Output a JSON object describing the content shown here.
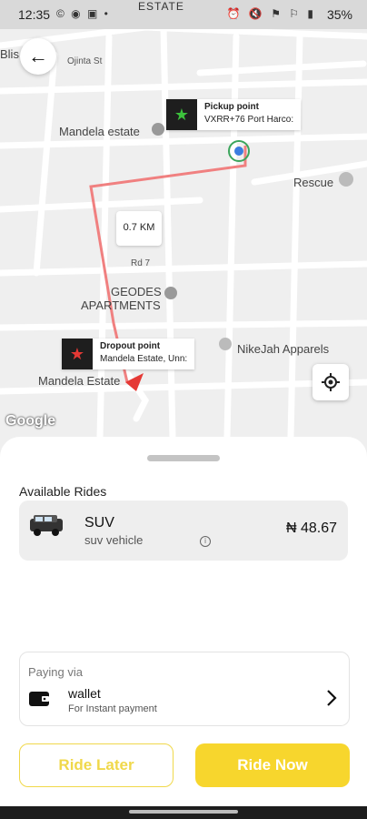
{
  "status_bar": {
    "time": "12:35",
    "battery": "35%",
    "left_icons": "© ◉ ▣ •",
    "right_icons": "⏰ 🔇 ⚑ ⚐ ▮"
  },
  "map": {
    "labels": {
      "estate_top": "ESTATE",
      "bliss": "Blis",
      "ojinta": "Ojinta St",
      "mandela_estate_top": "Mandela estate",
      "rescue": "Rescue",
      "rd7": "Rd 7",
      "geodes": "GEODES",
      "apartments": "APARTMENTS",
      "nikejah": "NikeJah Apparels",
      "mandela_estate_bottom": "Mandela Estate",
      "google": "Google"
    },
    "pickup": {
      "title": "Pickup point",
      "address": "VXRR+76 Port Harco:"
    },
    "dropoff": {
      "title": "Dropout point",
      "address": "Mandela Estate, Unn:"
    },
    "distance": "0.7 KM",
    "route_color": "#f08080"
  },
  "sheet": {
    "section_title": "Available Rides",
    "ride": {
      "name": "SUV",
      "description": "suv vehicle",
      "price": "₦ 48.67",
      "info_icon": "i"
    },
    "payment": {
      "label": "Paying via",
      "method": "wallet",
      "subtitle": "For Instant payment"
    },
    "buttons": {
      "later": "Ride Later",
      "now": "Ride Now"
    }
  },
  "colors": {
    "accent": "#f7d62d",
    "accent_outline": "#f0d84a"
  }
}
